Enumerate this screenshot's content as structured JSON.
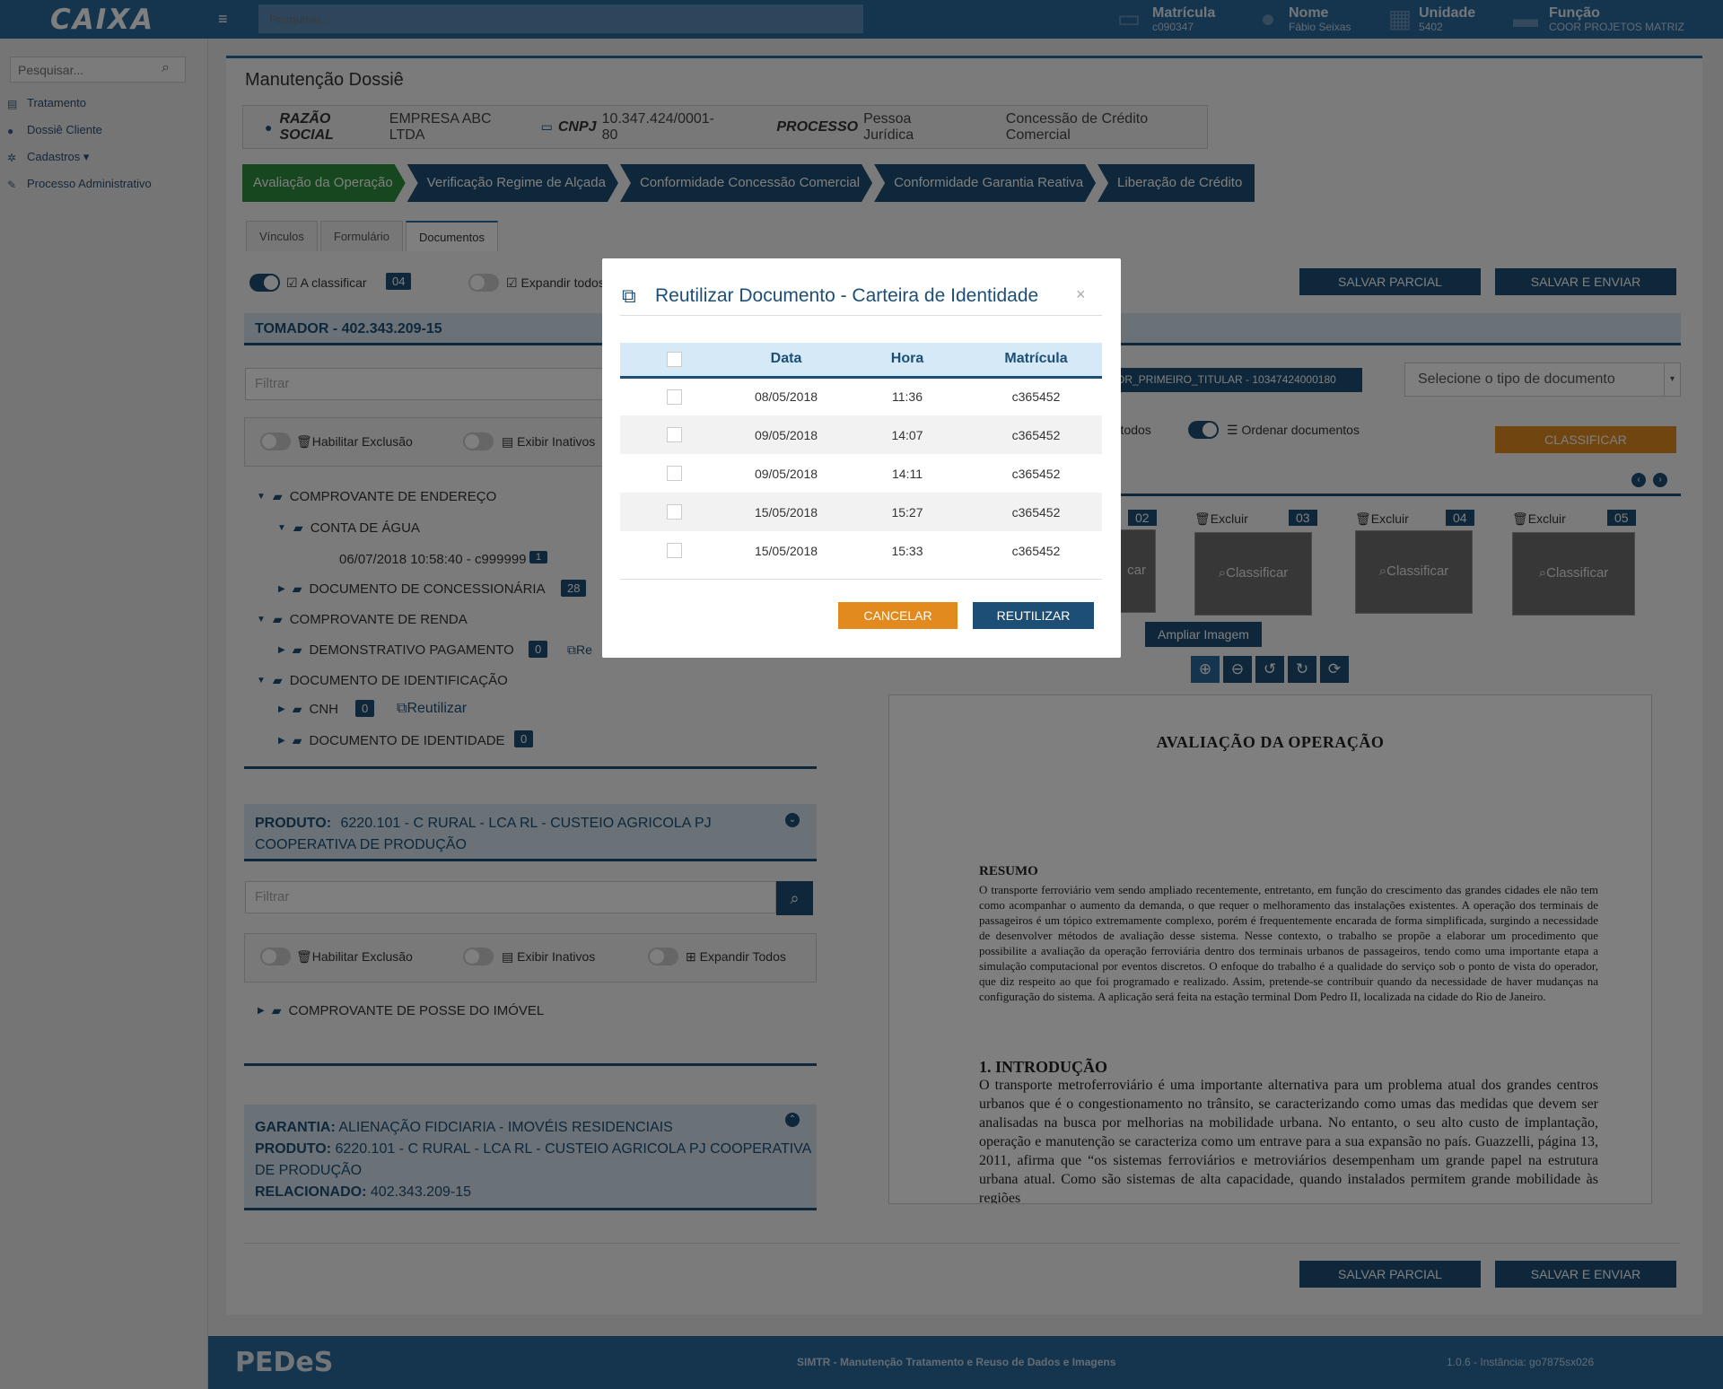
{
  "topbar": {
    "logo": "CAIXA",
    "menu_icon": "≡",
    "search_placeholder": "Pesquisar...",
    "matricula_label": "Matrícula",
    "matricula_value": "c090347",
    "nome_label": "Nome",
    "nome_value": "Fábio Seixas",
    "unidade_label": "Unidade",
    "unidade_value": "5402",
    "funcao_label": "Função",
    "funcao_value": "COOR PROJETOS MATRIZ"
  },
  "sidebar": {
    "search_placeholder": "Pesquisar...",
    "items": [
      {
        "label": "Tratamento",
        "icon": "table-icon"
      },
      {
        "label": "Dossiê Cliente",
        "icon": "user-icon"
      },
      {
        "label": "Cadastros ▾",
        "icon": "gear-icon"
      },
      {
        "label": "Processo Administrativo",
        "icon": "edit-icon"
      }
    ]
  },
  "page": {
    "title": "Manutenção Dossiê",
    "razao_label": "RAZÃO SOCIAL",
    "razao_value": "EMPRESA ABC LTDA",
    "cnpj_label": "CNPJ",
    "cnpj_value": "10.347.424/0001-80",
    "processo_label": "PROCESSO",
    "processo_value": "Pessoa Jurídica",
    "processo_extra": "Concessão de Crédito Comercial",
    "steps": [
      "Avaliação da Operação",
      "Verificação Regime de Alçada",
      "Conformidade Concessão Comercial",
      "Conformidade Garantia Reativa",
      "Liberação de Crédito"
    ],
    "tabs": [
      "Vínculos",
      "Formulário",
      "Documentos"
    ],
    "a_classificar": "A classificar",
    "a_classificar_count": "04",
    "expandir_todos": "Expandir todos",
    "salvar_parcial": "SALVAR PARCIAL",
    "salvar_enviar": "SALVAR E ENVIAR"
  },
  "tomador": {
    "header": "TOMADOR - 402.343.209-15",
    "filter_placeholder": "Filtrar",
    "habilitar_exclusao": "Habilitar Exclusão",
    "exibir_inativos": "Exibir Inativos",
    "tree": {
      "endereco": "COMPROVANTE DE ENDEREÇO",
      "agua": "CONTA DE ÁGUA",
      "agua_item": "06/07/2018 10:58:40 - c999999",
      "agua_item_count": "1",
      "concessionaria": "DOCUMENTO DE CONCESSIONÁRIA",
      "concessionaria_count": "28",
      "renda": "COMPROVANTE DE RENDA",
      "pagamento": "DEMONSTRATIVO PAGAMENTO",
      "pagamento_count": "0",
      "pagamento_action": "Re",
      "identificacao": "DOCUMENTO DE IDENTIFICAÇÃO",
      "cnh": "CNH",
      "cnh_count": "0",
      "reutilizar": "Reutilizar",
      "identidade": "DOCUMENTO DE IDENTIDADE",
      "identidade_count": "0"
    }
  },
  "produto": {
    "label": "PRODUTO:",
    "value": "6220.101 - C RURAL - LCA RL - CUSTEIO AGRICOLA PJ",
    "value2": "COOPERATIVA DE PRODUÇÃO",
    "filter_placeholder": "Filtrar",
    "habilitar_exclusao": "Habilitar Exclusão",
    "exibir_inativos": "Exibir Inativos",
    "expandir_todos": "Expandir Todos",
    "tree_item": "COMPROVANTE DE POSSE DO IMÓVEL"
  },
  "garantia": {
    "garantia_label": "GARANTIA:",
    "garantia_value": "ALIENAÇÃO FIDCIARIA - IMOVÉIS RESIDENCIAIS",
    "produto_label": "PRODUTO:",
    "produto_value": "6220.101 - C RURAL - LCA RL - CUSTEIO AGRICOLA PJ COOPERATIVA",
    "produto_value2": "DE PRODUÇÃO",
    "relacionado_label": "RELACIONADO:",
    "relacionado_value": "402.343.209-15"
  },
  "right": {
    "titular_select": "OR_PRIMEIRO_TITULAR - 10347424000180",
    "tipo_select": "Selecione o tipo de documento",
    "exibir_todos": "r todos",
    "ordenar": "Ordenar documentos",
    "classificar": "CLASSIFICAR",
    "thumbs": [
      {
        "num": "02",
        "label": "car",
        "excluir": ""
      },
      {
        "num": "03",
        "label": "Classificar",
        "excluir": "Excluir"
      },
      {
        "num": "04",
        "label": "Classificar",
        "excluir": "Excluir"
      },
      {
        "num": "05",
        "label": "Classificar",
        "excluir": "Excluir"
      }
    ],
    "tooltip": "Ampliar Imagem"
  },
  "document": {
    "title": "AVALIAÇÃO DA OPERAÇÃO",
    "resumo_title": "RESUMO",
    "resumo": "O transporte ferroviário vem sendo ampliado recentemente, entretanto, em função do crescimento das grandes cidades ele não tem como acompanhar o aumento da demanda, o que requer o melhoramento das instalações existentes. A operação dos terminais de passageiros é um tópico extremamente complexo, porém é frequentemente encarada de forma simplificada, surgindo a necessidade de desenvolver métodos de avaliação desse sistema. Nesse contexto, o trabalho se propõe a elaborar um procedimento que possibilite a avaliação da operação ferroviária dentro dos terminais urbanos de passageiros, tendo como uma importante etapa a simulação computacional por eventos discretos. O enfoque do trabalho é a qualidade do serviço sob o ponto de vista do operador, que diz respeito ao que foi programado e realizado. Assim, pretende-se contribuir quando da necessidade de haver mudanças na configuração do sistema. A aplicação será feita na estação terminal Dom Pedro II, localizada na cidade do Rio de Janeiro.",
    "intro_title": "1. INTRODUÇÃO",
    "intro": "O transporte metroferroviário é uma importante alternativa para um problema atual dos grandes centros urbanos que é o congestionamento no trânsito, se caracterizando como umas das medidas que devem ser analisadas na busca por melhorias na mobilidade urbana. No entanto, o seu alto custo de implantação, operação e manutenção se caracteriza como um entrave para a sua expansão no país. Guazzelli, página 13, 2011, afirma que “os sistemas ferroviários e metroviários desempenham um grande papel na estrutura urbana atual. Como são sistemas de alta capacidade, quando instalados permitem grande mobilidade às regiões"
  },
  "footer": {
    "logo": "PEDeS",
    "center": "SIMTR - Manutenção Tratamento e Reuso de Dados e Imagens",
    "right": "1.0.6 - Instância: go7875sx026"
  },
  "modal": {
    "title": "Reutilizar Documento - Carteira de Identidade",
    "close": "×",
    "columns": [
      "Data",
      "Hora",
      "Matrícula"
    ],
    "rows": [
      {
        "data": "08/05/2018",
        "hora": "11:36",
        "matricula": "c365452"
      },
      {
        "data": "09/05/2018",
        "hora": "14:07",
        "matricula": "c365452"
      },
      {
        "data": "09/05/2018",
        "hora": "14:11",
        "matricula": "c365452"
      },
      {
        "data": "15/05/2018",
        "hora": "15:27",
        "matricula": "c365452"
      },
      {
        "data": "15/05/2018",
        "hora": "15:33",
        "matricula": "c365452"
      }
    ],
    "cancel": "CANCELAR",
    "confirm": "REUTILIZAR"
  },
  "colors": {
    "primary": "#1d4f76",
    "topbar": "#2b6a9e",
    "success": "#2c8e3c",
    "accent": "#e38a1f",
    "header_bg": "#d5e3ef"
  }
}
